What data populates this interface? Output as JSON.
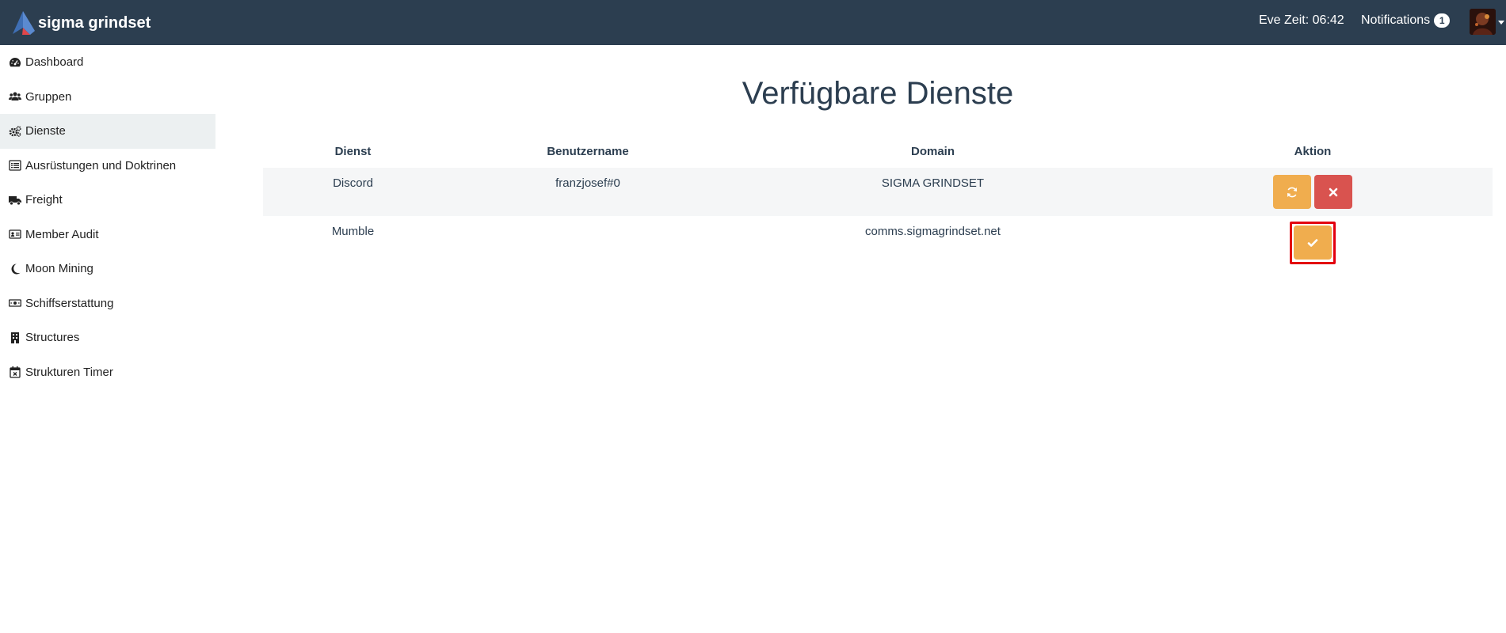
{
  "brand": {
    "name": "sigma grindset"
  },
  "header": {
    "eve_time": "Eve Zeit: 06:42",
    "notifications_label": "Notifications",
    "notifications_count": "1"
  },
  "sidebar": {
    "items": [
      {
        "label": "Dashboard",
        "icon": "dashboard-icon"
      },
      {
        "label": "Gruppen",
        "icon": "users-icon"
      },
      {
        "label": "Dienste",
        "icon": "cogs-icon",
        "active": true
      },
      {
        "label": "Ausrüstungen und Doktrinen",
        "icon": "list-icon"
      },
      {
        "label": "Freight",
        "icon": "truck-icon"
      },
      {
        "label": "Member Audit",
        "icon": "id-card-icon"
      },
      {
        "label": "Moon Mining",
        "icon": "moon-icon"
      },
      {
        "label": "Schiffserstattung",
        "icon": "money-bill-icon"
      },
      {
        "label": "Structures",
        "icon": "building-icon"
      },
      {
        "label": "Strukturen Timer",
        "icon": "calendar-times-icon"
      }
    ]
  },
  "main": {
    "title": "Verfügbare Dienste",
    "columns": [
      "Dienst",
      "Benutzername",
      "Domain",
      "Aktion"
    ],
    "rows": [
      {
        "dienst": "Discord",
        "benutzername": "franzjosef#0",
        "domain": "SIGMA GRINDSET",
        "actions": [
          "refresh",
          "delete"
        ]
      },
      {
        "dienst": "Mumble",
        "benutzername": "",
        "domain": "comms.sigmagrindset.net",
        "actions": [
          "activate"
        ]
      }
    ]
  },
  "colors": {
    "navbar": "#2c3e50",
    "warning": "#f0ad4e",
    "danger": "#d9534f",
    "highlight": "#e3000f"
  }
}
